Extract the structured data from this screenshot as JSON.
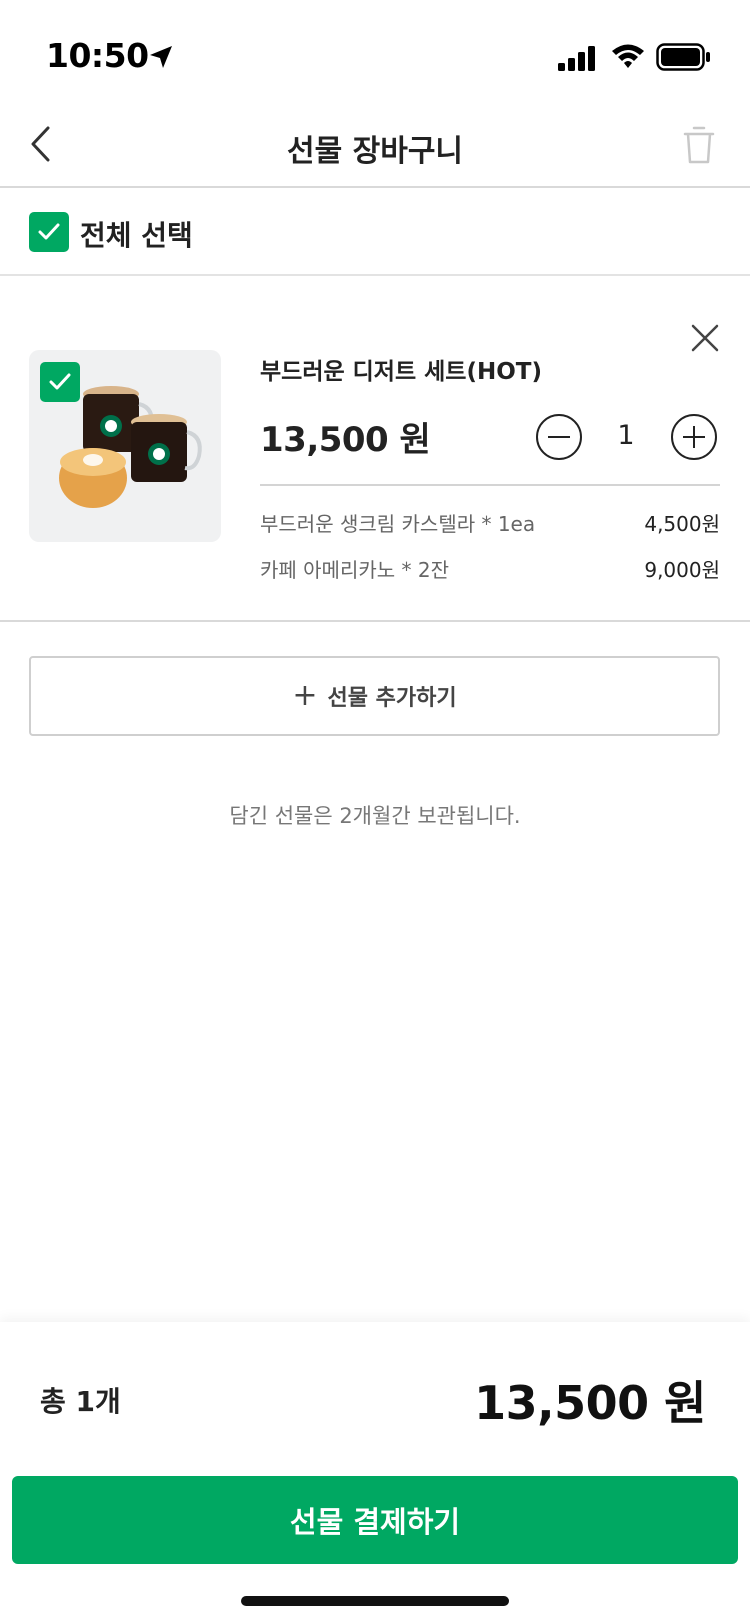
{
  "status_bar": {
    "time": "10:50"
  },
  "header": {
    "title": "선물 장바구니"
  },
  "select_all": {
    "label": "전체 선택",
    "checked": true
  },
  "cart_item": {
    "name": "부드러운 디저트 세트(HOT)",
    "price": "13,500 원",
    "quantity": "1",
    "checked": true,
    "options": [
      {
        "name": "부드러운 생크림 카스텔라 * 1ea",
        "price": "4,500원"
      },
      {
        "name": "카페 아메리카노 * 2잔",
        "price": "9,000원"
      }
    ]
  },
  "add_gift": {
    "icon": "+",
    "label": "선물 추가하기"
  },
  "storage_note": "담긴 선물은 2개월간 보관됩니다.",
  "footer": {
    "total_count": "총 1개",
    "total_amount": "13,500 원",
    "checkout_label": "선물 결제하기"
  },
  "colors": {
    "accent": "#00a862",
    "divider": "#d9d9d9",
    "text": "#222222"
  }
}
